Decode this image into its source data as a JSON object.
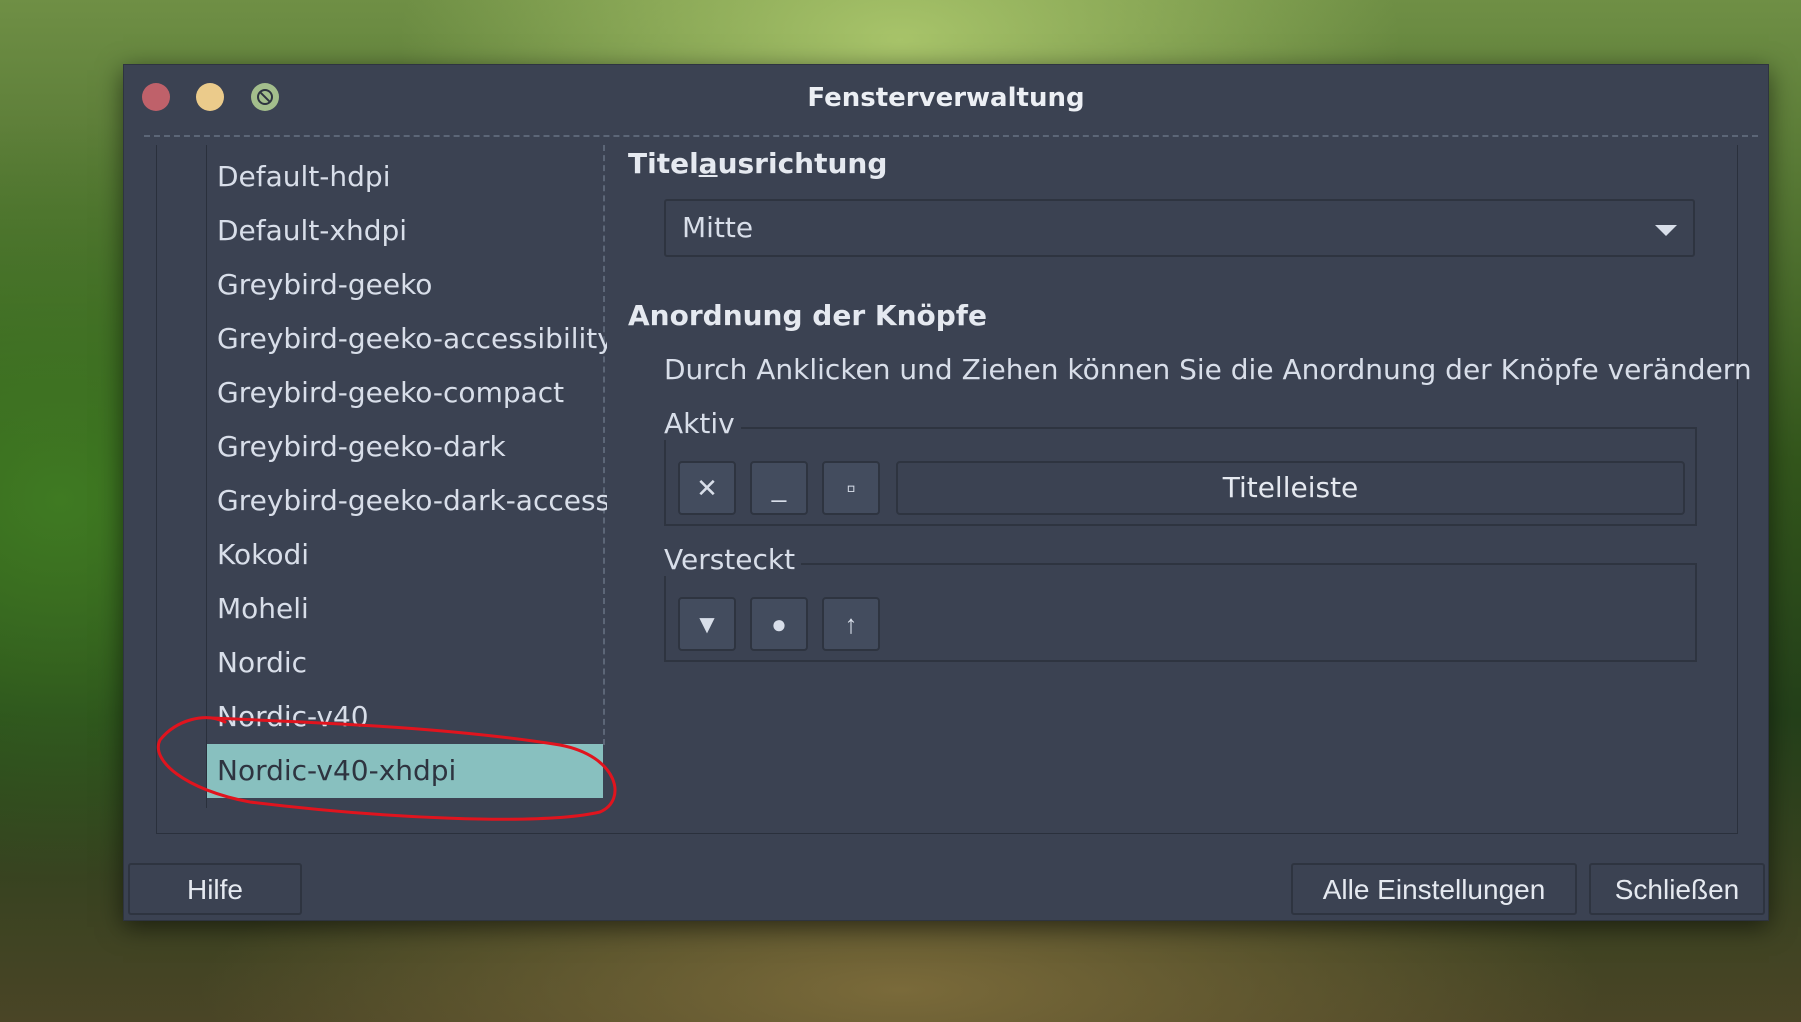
{
  "window": {
    "title": "Fensterverwaltung"
  },
  "themes": {
    "items": [
      "Default-hdpi",
      "Default-xhdpi",
      "Greybird-geeko",
      "Greybird-geeko-accessibility",
      "Greybird-geeko-compact",
      "Greybird-geeko-dark",
      "Greybird-geeko-dark-accessibi",
      "Kokodi",
      "Moheli",
      "Nordic",
      "Nordic-v40",
      "Nordic-v40-xhdpi"
    ],
    "selected": "Nordic-v40-xhdpi"
  },
  "title_alignment": {
    "label_pre": "Titel",
    "label_mnemonic": "a",
    "label_post": "usrichtung",
    "value": "Mitte"
  },
  "button_layout": {
    "heading": "Anordnung der Knöpfe",
    "hint": "Durch Anklicken und Ziehen können Sie die Anordnung der Knöpfe verändern",
    "active_label": "Aktiv",
    "active_buttons": [
      {
        "icon": "close-icon",
        "glyph": "✕"
      },
      {
        "icon": "minimize-icon",
        "glyph": "_"
      },
      {
        "icon": "maximize-icon",
        "glyph": "▫"
      }
    ],
    "titlebar_label": "Titelleiste",
    "hidden_label": "Versteckt",
    "hidden_buttons": [
      {
        "icon": "shade-icon",
        "glyph": "▼"
      },
      {
        "icon": "stick-icon",
        "glyph": "●"
      },
      {
        "icon": "above-icon",
        "glyph": "↑"
      }
    ]
  },
  "footer": {
    "help_label": "Hilfe",
    "all_settings_label": "Alle Einstellungen",
    "close_label": "Schließen"
  },
  "colors": {
    "window_bg": "#3b4252",
    "selection": "#88c0bf",
    "close": "#bf616a",
    "minimize": "#ebcb8b",
    "maximize": "#a3be8c",
    "annotation": "#e0141e"
  }
}
